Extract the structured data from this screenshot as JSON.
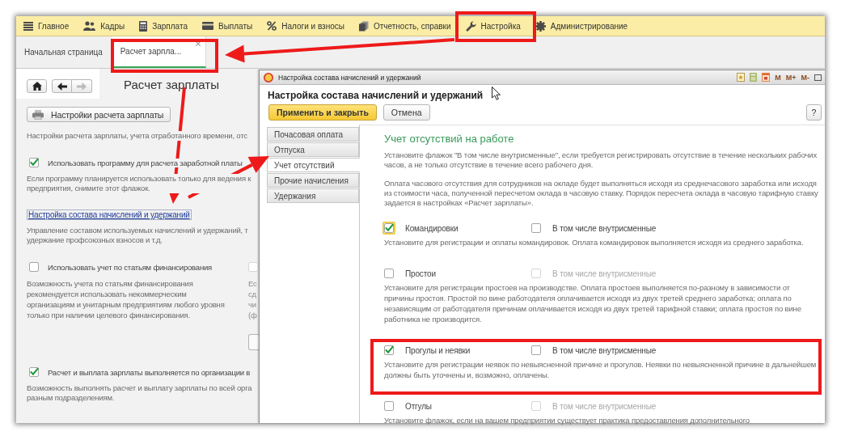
{
  "menu_bar": [
    {
      "label": "Главное",
      "highlighted": false
    },
    {
      "label": "Кадры",
      "highlighted": false
    },
    {
      "label": "Зарплата",
      "highlighted": false
    },
    {
      "label": "Выплаты",
      "highlighted": false
    },
    {
      "label": "Налоги и взносы",
      "highlighted": false
    },
    {
      "label": "Отчетность, справки",
      "highlighted": false
    },
    {
      "label": "Настройка",
      "highlighted": true
    },
    {
      "label": "Администрирование",
      "highlighted": false
    }
  ],
  "open_tabs": [
    {
      "label": "Начальная страница",
      "selected": false,
      "closable": false,
      "highlighted": false
    },
    {
      "label": "Расчет зарпла...",
      "selected": true,
      "closable": true,
      "highlighted": true
    }
  ],
  "left_panel": {
    "nav_buttons": [
      {
        "kind": "home",
        "disabled": false
      },
      {
        "kind": "back",
        "disabled": false
      },
      {
        "kind": "forward",
        "disabled": true
      }
    ],
    "title": "Расчет зарплаты",
    "settings_button": "Настройки расчета зарплаты",
    "sections": [
      {
        "kind": "text",
        "text": "Настройки расчета зарплаты, учета отработанного времени, отс"
      },
      {
        "kind": "checkbox",
        "label": "Использовать программу для расчета заработной платы",
        "checked": true
      },
      {
        "kind": "text",
        "text": "Если программу планируется использовать только для ведения к\nпредприятия, снимите этот флажок."
      },
      {
        "kind": "link",
        "text": "Настройка состава начислений и удержаний"
      },
      {
        "kind": "text",
        "text": "Управление составом используемых начислений и удержаний, т\nудержание профсоюзных взносов и т.д."
      },
      {
        "kind": "pair",
        "label": "Использовать учет по статьям финансирования",
        "checked": false,
        "text": "Возможность учета по статьям финансирования\nрекомендуется использовать некоммерческим\nорганизациям и унитарным предприятиям любого уровня\nтолько при наличии целевого финансирования.",
        "side": {
          "checked": false,
          "disabled": true,
          "text": "Ес\nсд\nчи\n(ф"
        }
      },
      {
        "kind": "checkbox",
        "label": "Расчет и выплата зарплаты выполняется по организации в",
        "checked": true
      },
      {
        "kind": "text",
        "text": "Возможность выполнять расчет и выплату зарплаты по всей орга\nразным подразделениям."
      }
    ]
  },
  "dialog": {
    "title": "Настройка состава начислений и удержаний",
    "memory_buttons": [
      "M",
      "M+",
      "M-"
    ],
    "heading": "Настройка состава начислений и удержаний",
    "buttons": [
      {
        "label": "Применить и закрыть",
        "kind": "primary"
      },
      {
        "label": "Отмена",
        "kind": "normal"
      }
    ],
    "help_button": "?",
    "sections": [
      {
        "label": "Почасовая оплата",
        "selected": false
      },
      {
        "label": "Отпуска",
        "selected": false
      },
      {
        "label": "Учет отсутствий",
        "selected": true
      },
      {
        "label": "Прочие начисления",
        "selected": false
      },
      {
        "label": "Удержания",
        "selected": false
      }
    ],
    "content": {
      "title": "Учет отсутствий на работе",
      "paragraphs": [
        "Установите флажок \"В том числе внутрисменные\", если требуется регистрировать отсутствие в течение нескольких рабочих часов, а не только отсутствие в течение всего рабочего дня.",
        "Оплата часового отсутствия для сотрудников на окладе будет выполняться исходя из среднечасового заработка или исходя из стоимости часа, полученной пересчетом оклада в часовую ставку. Порядок пересчета оклада в часовую тарифную ставку задается в настройках «Расчет зарплаты»."
      ],
      "rows": [
        {
          "label": "Командировки",
          "checked": true,
          "focused": true,
          "sub_label": "В том числе внутрисменные",
          "sub_checked": false,
          "sub_disabled": false,
          "highlighted": false,
          "description": "Установите для регистрации и оплаты командировок. Оплата командировок выполняется исходя из среднего заработка."
        },
        {
          "label": "Простои",
          "checked": false,
          "focused": false,
          "sub_label": "В том числе внутрисменные",
          "sub_checked": false,
          "sub_disabled": true,
          "highlighted": false,
          "description": "Установите для регистрации простоев на производстве. Оплата простоев выполняется по-разному в зависимости от причины простоя. Простой по вине работодателя оплачивается исходя из двух третей среднего заработка; оплата по независящим от работодателя причинам оплачивается исходя из двух третей тарифной ставки; оплата простоя по вине работника не производится."
        },
        {
          "label": "Прогулы и неявки",
          "checked": true,
          "focused": false,
          "sub_label": "В том числе внутрисменные",
          "sub_checked": false,
          "sub_disabled": false,
          "highlighted": true,
          "description": "Установите для регистрации неявок по невыясненной причине и прогулов. Неявки по невыясненной причине в дальнейшем должны быть уточнены и, возможно, оплачены."
        },
        {
          "label": "Отгулы",
          "checked": false,
          "focused": false,
          "sub_label": "В том числе внутрисменные",
          "sub_checked": false,
          "sub_disabled": true,
          "highlighted": false,
          "description": "Установите флажок, если на вашем предприятии существует практика предоставления дополнительного"
        }
      ]
    }
  }
}
